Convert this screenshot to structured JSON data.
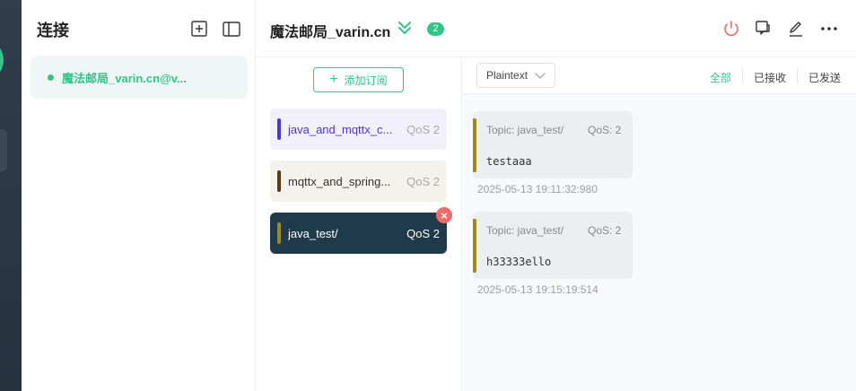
{
  "sidebar": {
    "title": "连接",
    "connections": [
      {
        "name": "魔法邮局_varin.cn@v..."
      }
    ]
  },
  "header": {
    "title": "魔法邮局_varin.cn",
    "subscription_count": "2"
  },
  "subscriptions": {
    "add_label": "添加订阅",
    "items": [
      {
        "topic": "java_and_mqttx_c...",
        "qos": "QoS 2",
        "color": "#4b35d6"
      },
      {
        "topic": "mqttx_and_spring...",
        "qos": "QoS 2",
        "color": "#5a3a10"
      },
      {
        "topic": "java_test/",
        "qos": "QoS 2",
        "color": "#9a8b1a"
      }
    ]
  },
  "messages": {
    "format": "Plaintext",
    "filters": [
      "全部",
      "已接收",
      "已发送"
    ],
    "items": [
      {
        "topic": "Topic: java_test/",
        "qos": "QoS: 2",
        "payload": "testaaa",
        "time": "2025-05-13 19:11:32:980"
      },
      {
        "topic": "Topic: java_test/",
        "qos": "QoS: 2",
        "payload": "h33333ello",
        "time": "2025-05-13 19:15:19:514"
      }
    ]
  },
  "colors": {
    "accent": "#34c388",
    "danger": "#ef6a6a",
    "active_subscription_bg": "#1f3a4b"
  }
}
